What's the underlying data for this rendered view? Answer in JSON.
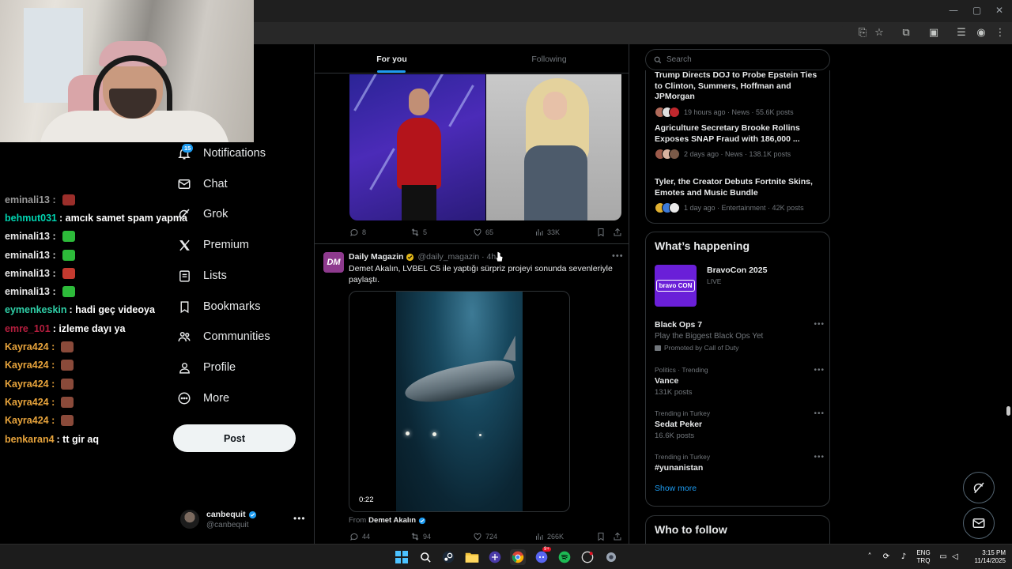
{
  "chat": [
    {
      "user": "eminali13 :",
      "color": "#9a9a9a",
      "msg": "",
      "emote": "#9b2e2a"
    },
    {
      "user": "behmut031",
      "color": "#00d4b0",
      "msg": ": amcık samet spam yapma",
      "emote": ""
    },
    {
      "user": "eminali13 :",
      "color": "#e7e7e7",
      "msg": "",
      "emote": "#2dbb3a"
    },
    {
      "user": "eminali13 :",
      "color": "#e7e7e7",
      "msg": "",
      "emote": "#2dbb3a"
    },
    {
      "user": "eminali13 :",
      "color": "#e7e7e7",
      "msg": "",
      "emote": "#c43a2f"
    },
    {
      "user": "eminali13 :",
      "color": "#e7e7e7",
      "msg": "",
      "emote": "#2dbb3a"
    },
    {
      "user": "eymenkeskin",
      "color": "#2fd0a8",
      "msg": ": hadi geç videoya",
      "emote": ""
    },
    {
      "user": "emre_101",
      "color": "#b51e3e",
      "msg": ": izleme dayı ya",
      "emote": ""
    },
    {
      "user": "Kayra424 :",
      "color": "#e8a43c",
      "msg": "",
      "emote": "#8a4a3a"
    },
    {
      "user": "Kayra424 :",
      "color": "#e8a43c",
      "msg": "",
      "emote": "#8a4a3a"
    },
    {
      "user": "Kayra424 :",
      "color": "#e8a43c",
      "msg": "",
      "emote": "#8a4a3a"
    },
    {
      "user": "Kayra424 :",
      "color": "#e8a43c",
      "msg": "",
      "emote": "#8a4a3a"
    },
    {
      "user": "Kayra424 :",
      "color": "#e8a43c",
      "msg": "",
      "emote": "#8a4a3a"
    },
    {
      "user": "benkaran4",
      "color": "#e8a43c",
      "msg": ": tt gir aq",
      "emote": ""
    }
  ],
  "nav": {
    "notifications_badge": "15",
    "items": [
      {
        "label": "Notifications",
        "icon": "bell-icon"
      },
      {
        "label": "Chat",
        "icon": "mail-icon"
      },
      {
        "label": "Grok",
        "icon": "grok-icon"
      },
      {
        "label": "Premium",
        "icon": "x-logo-icon"
      },
      {
        "label": "Lists",
        "icon": "list-icon"
      },
      {
        "label": "Bookmarks",
        "icon": "bookmark-icon"
      },
      {
        "label": "Communities",
        "icon": "communities-icon"
      },
      {
        "label": "Profile",
        "icon": "person-icon"
      },
      {
        "label": "More",
        "icon": "more-circle-icon"
      }
    ],
    "post_label": "Post"
  },
  "account": {
    "name": "canbequit",
    "handle": "@canbequit"
  },
  "feed": {
    "tabs": [
      "For you",
      "Following"
    ],
    "tweet1_stats": {
      "replies": "8",
      "reposts": "5",
      "likes": "65",
      "views": "33K"
    },
    "tweet2": {
      "avatar": "DM",
      "name": "Daily Magazin",
      "meta": "@daily_magazin · 4h",
      "text": "Demet Akalın, LVBEL C5 ile yaptığı sürpriz projeyi sonunda sevenleriyle paylaştı.",
      "duration": "0:22",
      "from_label": "From",
      "from_name": "Demet Akalın",
      "stats": {
        "replies": "44",
        "reposts": "94",
        "likes": "724",
        "views": "266K"
      }
    }
  },
  "search": {
    "placeholder": "Search"
  },
  "news": [
    {
      "title": "Trump Directs DOJ to Probe Epstein Ties to Clinton, Summers, Hoffman and JPMorgan",
      "meta": "19 hours ago · News · 55.6K posts",
      "faces": [
        "#b06a5a",
        "#e0e0e0",
        "#c0272d"
      ]
    },
    {
      "title": "Agriculture Secretary Brooke Rollins Exposes SNAP Fraud with 186,000 ...",
      "meta": "2 days ago · News · 138.1K posts",
      "faces": [
        "#9c5a4a",
        "#d9b3a0",
        "#7a5a48"
      ]
    },
    {
      "title": "Tyler, the Creator Debuts Fortnite Skins, Emotes and Music Bundle",
      "meta": "1 day ago · Entertainment · 42K posts",
      "faces": [
        "#e0b030",
        "#3d7ad8",
        "#eaeaea"
      ]
    }
  ],
  "happening": {
    "title": "What’s happening",
    "event": {
      "title": "BravoCon 2025",
      "status": "LIVE",
      "logo": "bravo CON"
    },
    "promoted": {
      "name": "Black Ops 7",
      "tagline": "Play the Biggest Black Ops Yet",
      "promo": "Promoted by Call of Duty"
    },
    "trends": [
      {
        "context": "Politics · Trending",
        "name": "Vance",
        "posts": "131K posts"
      },
      {
        "context": "Trending in Turkey",
        "name": "Sedat Peker",
        "posts": "16.6K posts"
      },
      {
        "context": "Trending in Turkey",
        "name": "#yunanistan",
        "posts": ""
      }
    ],
    "show_more": "Show more"
  },
  "who_to_follow": {
    "title": "Who to follow"
  },
  "tray": {
    "lang_top": "ENG",
    "lang_bottom": "TRQ",
    "time": "3:15 PM",
    "date": "11/14/2025"
  },
  "taskbar_badge": "9+"
}
